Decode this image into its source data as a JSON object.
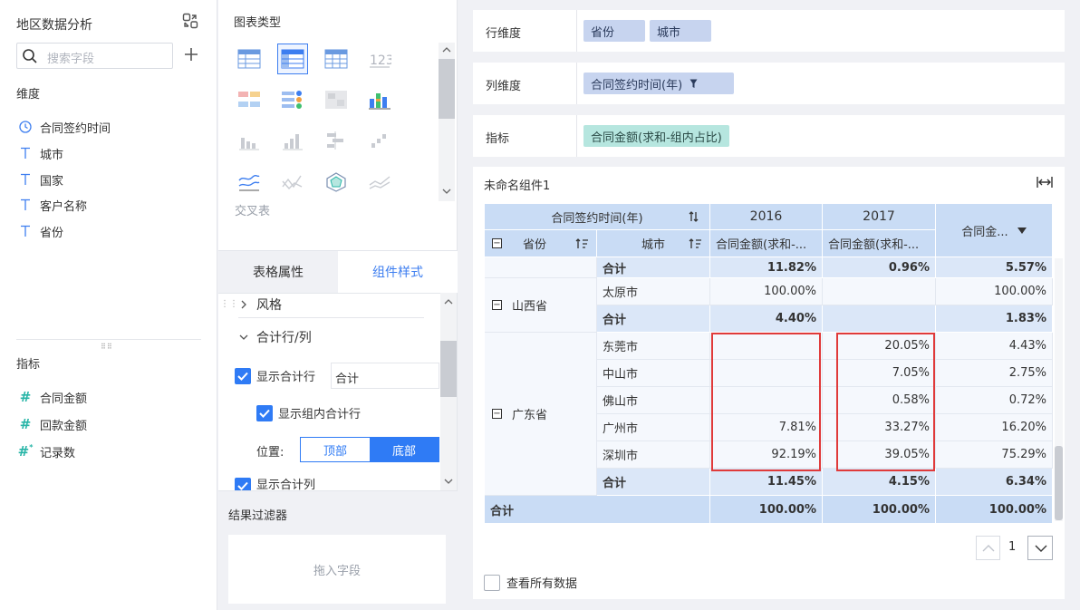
{
  "left": {
    "title": "地区数据分析",
    "search_placeholder": "搜索字段",
    "dimension_title": "维度",
    "dimensions": [
      {
        "label": "合同签约时间",
        "icon": "clock-icon"
      },
      {
        "label": "城市",
        "icon": "text-type-icon"
      },
      {
        "label": "国家",
        "icon": "text-type-icon"
      },
      {
        "label": "客户名称",
        "icon": "text-type-icon"
      },
      {
        "label": "省份",
        "icon": "text-type-icon"
      }
    ],
    "measure_title": "指标",
    "measures": [
      {
        "label": "合同金额",
        "icon": "number-icon"
      },
      {
        "label": "回款金额",
        "icon": "number-icon"
      },
      {
        "label": "记录数",
        "icon": "number-calc-icon"
      }
    ]
  },
  "mid": {
    "chart_type_title": "图表类型",
    "chart_type_label": "交叉表",
    "tabs": [
      "表格属性",
      "组件样式"
    ],
    "style": {
      "section_style": "风格",
      "section_total": "合计行/列",
      "show_total_row": "显示合计行",
      "total_row_text": "合计",
      "show_group_total": "显示组内合计行",
      "position_label": "位置:",
      "position_options": [
        "顶部",
        "底部"
      ],
      "show_total_col": "显示合计列"
    },
    "filter_title": "结果过滤器",
    "filter_drop": "拖入字段"
  },
  "rows_dim": {
    "label": "行维度",
    "pills": [
      "省份",
      "城市"
    ]
  },
  "cols_dim": {
    "label": "列维度",
    "pills": [
      "合同签约时间(年)"
    ]
  },
  "measure": {
    "label": "指标",
    "pills": [
      "合同金额(求和-组内占比)"
    ]
  },
  "component": {
    "name": "未命名组件1",
    "header": {
      "col_dim": "合同签约时间(年)",
      "years": [
        "2016",
        "2017"
      ],
      "prov": "省份",
      "city": "城市",
      "measure_short": "合同金额(求和-...",
      "total_col": "合同金..."
    },
    "rows": [
      {
        "city": "合计",
        "v2016": "11.82%",
        "v2017": "0.96%",
        "total": "5.57%"
      },
      {
        "city": "太原市",
        "v2016": "100.00%",
        "v2017": "",
        "total": "100.00%"
      },
      {
        "city": "合计",
        "v2016": "4.40%",
        "v2017": "",
        "total": "1.83%"
      },
      {
        "city": "东莞市",
        "v2016": "",
        "v2017": "20.05%",
        "total": "4.43%"
      },
      {
        "city": "中山市",
        "v2016": "",
        "v2017": "7.05%",
        "total": "2.75%"
      },
      {
        "city": "佛山市",
        "v2016": "",
        "v2017": "0.58%",
        "total": "0.72%"
      },
      {
        "city": "广州市",
        "v2016": "7.81%",
        "v2017": "33.27%",
        "total": "16.20%"
      },
      {
        "city": "深圳市",
        "v2016": "92.19%",
        "v2017": "39.05%",
        "total": "75.29%"
      },
      {
        "city": "合计",
        "v2016": "11.45%",
        "v2017": "4.15%",
        "total": "6.34%"
      }
    ],
    "provinces": {
      "shanxi": "山西省",
      "guangdong": "广东省"
    },
    "grand_total": {
      "label": "合计",
      "v2016": "100.00%",
      "v2017": "100.00%",
      "total": "100.00%"
    },
    "page": "1",
    "see_all": "查看所有数据"
  }
}
